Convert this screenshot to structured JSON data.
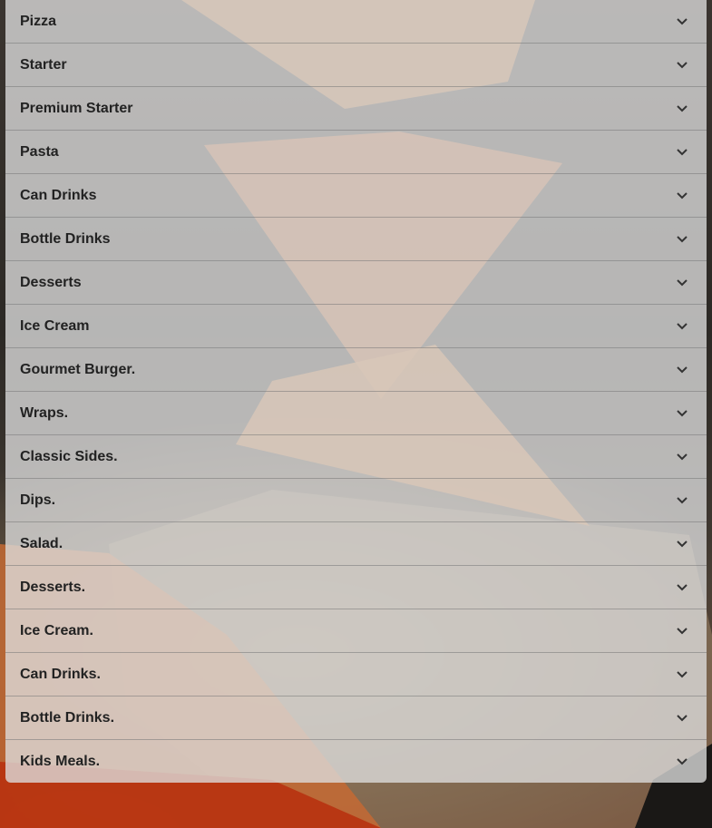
{
  "accordion": {
    "items": [
      {
        "label": "Pizza"
      },
      {
        "label": "Starter"
      },
      {
        "label": "Premium Starter"
      },
      {
        "label": "Pasta"
      },
      {
        "label": "Can Drinks"
      },
      {
        "label": "Bottle Drinks"
      },
      {
        "label": "Desserts"
      },
      {
        "label": "Ice Cream"
      },
      {
        "label": "Gourmet Burger."
      },
      {
        "label": "Wraps."
      },
      {
        "label": "Classic Sides."
      },
      {
        "label": "Dips."
      },
      {
        "label": "Salad."
      },
      {
        "label": "Desserts."
      },
      {
        "label": "Ice Cream."
      },
      {
        "label": "Can Drinks."
      },
      {
        "label": "Bottle Drinks."
      },
      {
        "label": "Kids Meals."
      }
    ],
    "chevron_icon": "chevron-down-icon"
  }
}
